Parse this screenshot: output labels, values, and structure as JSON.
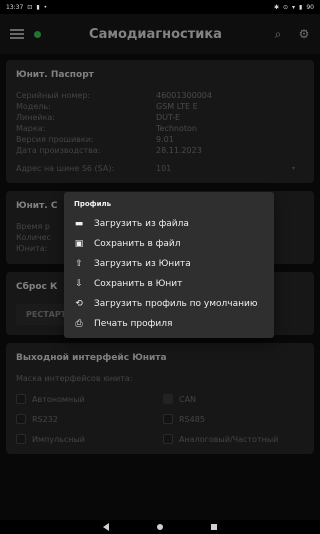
{
  "status_bar": {
    "time": "13:37",
    "left_icons": [
      "notification-icon",
      "sim-icon",
      "dot-icon"
    ],
    "right_text": "90"
  },
  "app_bar": {
    "title": "Самодиагностика"
  },
  "passport": {
    "title": "Юнит. Паспорт",
    "rows": [
      {
        "label": "Серийный номер:",
        "value": "46001300004"
      },
      {
        "label": "Модель:",
        "value": "GSM LTE E"
      },
      {
        "label": "Линейка:",
        "value": "DUT-E"
      },
      {
        "label": "Марка:",
        "value": "Technoton"
      },
      {
        "label": "Версия прошивки:",
        "value": "9.01"
      },
      {
        "label": "Дата производства:",
        "value": "28.11.2023"
      }
    ],
    "address_label": "Адрес на шине S6 (SA):",
    "address_value": "101"
  },
  "card2": {
    "title": "Юнит. С",
    "line1": "Время р",
    "line2": "Количес",
    "line3": "Юнита:"
  },
  "reset": {
    "title": "Сброс К",
    "button": "РЕСТАРТ"
  },
  "interface": {
    "title": "Выходной интерфейс Юнита",
    "subtitle": "Маска интерфейсов юнита:",
    "options": [
      {
        "label": "Автономный",
        "checked": false
      },
      {
        "label": "CAN",
        "checked": true
      },
      {
        "label": "RS232",
        "checked": false
      },
      {
        "label": "RS485",
        "checked": false
      },
      {
        "label": "Импульсный",
        "checked": false
      },
      {
        "label": "Аналоговый/Частотный",
        "checked": false
      }
    ]
  },
  "menu": {
    "title": "Профиль",
    "items": [
      {
        "label": "Загрузить из файла",
        "icon": "folder-icon"
      },
      {
        "label": "Сохранить в файл",
        "icon": "save-icon"
      },
      {
        "label": "Загрузить из Юнита",
        "icon": "upload-icon"
      },
      {
        "label": "Сохранить в Юнит",
        "icon": "download-icon"
      },
      {
        "label": "Загрузить профиль по умолчанию",
        "icon": "restore-icon"
      },
      {
        "label": "Печать профиля",
        "icon": "print-icon"
      }
    ]
  }
}
